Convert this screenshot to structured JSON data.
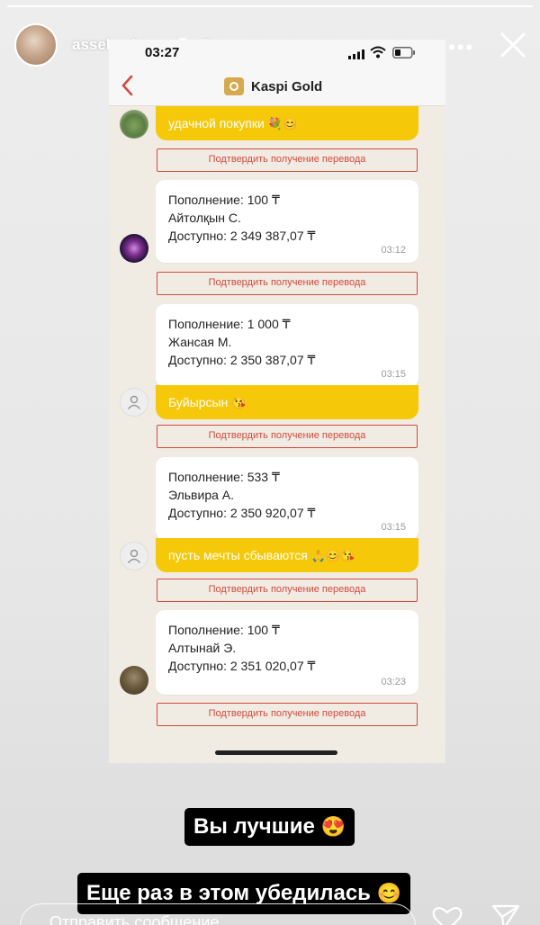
{
  "story": {
    "username": "assel.askar",
    "time_ago": "7ч.",
    "more_label": "•••",
    "caption_1": "Вы лучшие",
    "caption_1_emoji": "😍",
    "caption_2": "Еще раз в этом убедилась",
    "caption_2_emoji": "😊",
    "reply_placeholder": "Отправить сообщение",
    "progress_fraction": 1
  },
  "phone": {
    "status_time": "03:27",
    "app_title": "Kaspi Gold",
    "colors": {
      "message_yellow": "#f6c80a",
      "confirm_red": "#d44a3d",
      "chat_background": "#f0ebe3",
      "kaspi_gold": "#d6a94e"
    },
    "confirm_label": "Подтвердить получение перевода",
    "messages": [
      {
        "text": "удачной покупки",
        "emoji": "💐😊"
      },
      {
        "title": "Пополнение: 100 ₸",
        "sender": "Айтолқын С.",
        "balance": "Доступно: 2 349 387,07 ₸",
        "time": "03:12"
      },
      {
        "title": "Пополнение: 1 000 ₸",
        "sender": "Жансая М.",
        "balance": "Доступно: 2 350 387,07 ₸",
        "time": "03:15",
        "text": "Буйырсын",
        "emoji": "😘"
      },
      {
        "title": "Пополнение: 533 ₸",
        "sender": "Эльвира А.",
        "balance": "Доступно: 2 350 920,07 ₸",
        "time": "03:15",
        "text": "пусть мечты сбываются",
        "emoji": "🙏😊😘"
      },
      {
        "title": "Пополнение: 100 ₸",
        "sender": "Алтынай Э.",
        "balance": "Доступно: 2 351 020,07 ₸",
        "time": "03:23"
      }
    ]
  },
  "icons": [
    "verified-icon",
    "more-icon",
    "close-icon",
    "signal-icon",
    "wifi-icon",
    "battery-icon",
    "back-icon",
    "kaspi-logo-icon",
    "user-icon",
    "heart-icon",
    "send-icon"
  ]
}
